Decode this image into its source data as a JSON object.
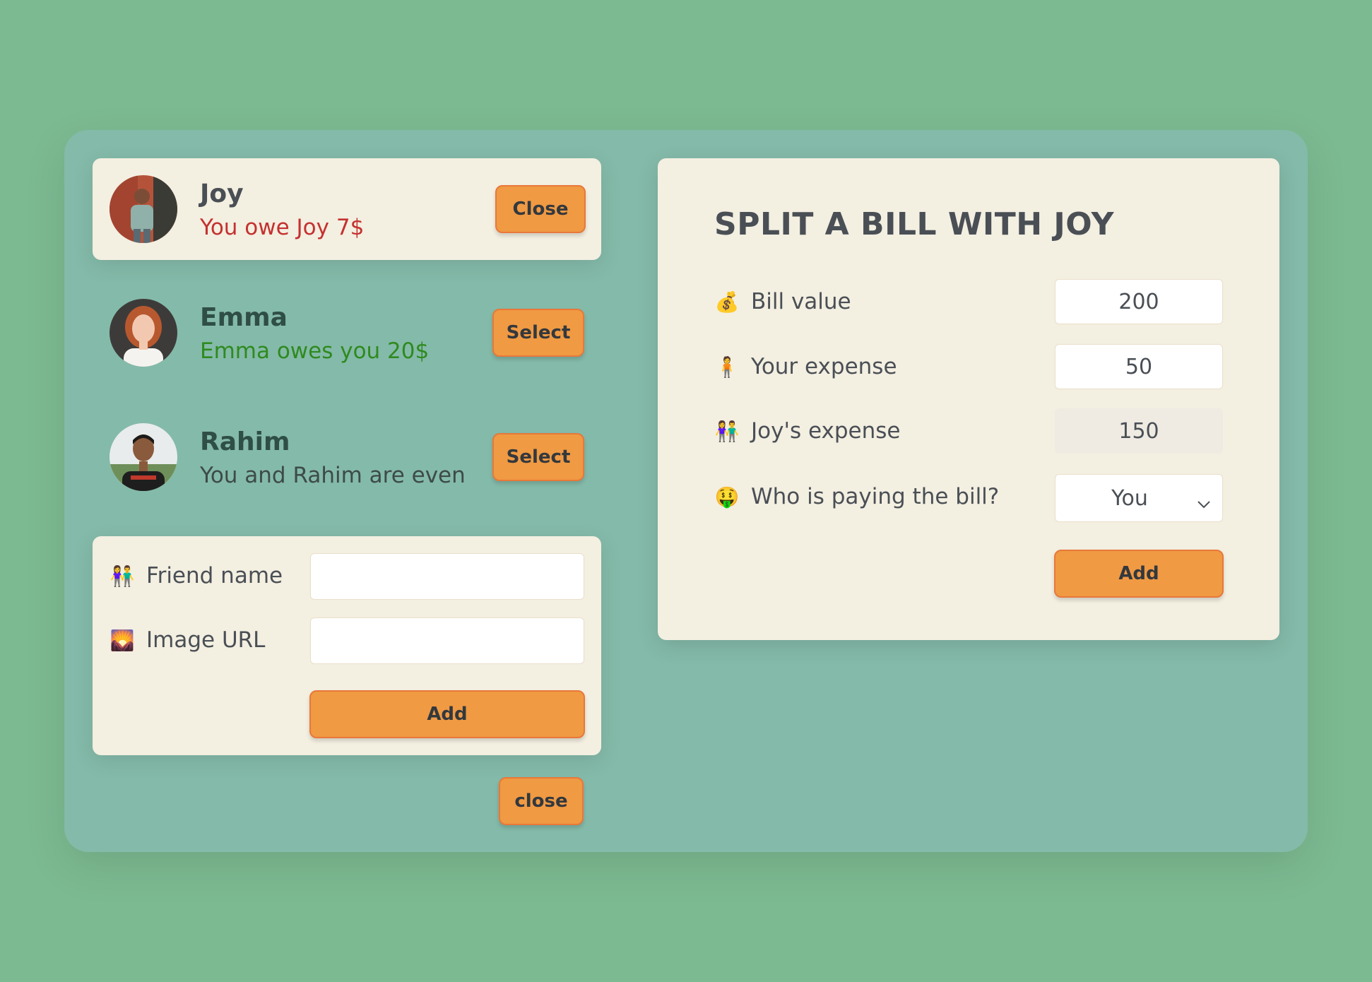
{
  "friends": [
    {
      "name": "Joy",
      "status": "You owe Joy 7$",
      "button": "Close",
      "selected": true
    },
    {
      "name": "Emma",
      "status": "Emma owes you 20$",
      "button": "Select",
      "selected": false
    },
    {
      "name": "Rahim",
      "status": "You and Rahim are even",
      "button": "Select",
      "selected": false
    }
  ],
  "add_friend": {
    "name_label": "Friend name",
    "name_emoji": "👫",
    "name_value": "",
    "image_label": "Image URL",
    "image_emoji": "🌄",
    "image_value": "",
    "add_button": "Add"
  },
  "close_button": "close",
  "split": {
    "title": "SPLIT A BILL WITH JOY",
    "bill_label": "Bill value",
    "bill_emoji": "💰",
    "bill_value": "200",
    "your_label": "Your expense",
    "your_emoji": "🧍",
    "your_value": "50",
    "friend_label": "Joy's expense",
    "friend_emoji": "👫",
    "friend_value": "150",
    "payer_label": "Who is paying the bill?",
    "payer_emoji": "🤑",
    "payer_value": "You",
    "add_button": "Add"
  },
  "colors": {
    "page_bg": "#7cba91",
    "app_bg": "#84baa9",
    "card_bg": "#f3efe1",
    "button": "#f09a43",
    "owe_red": "#c4312f",
    "owed_green": "#2f8a1f"
  }
}
